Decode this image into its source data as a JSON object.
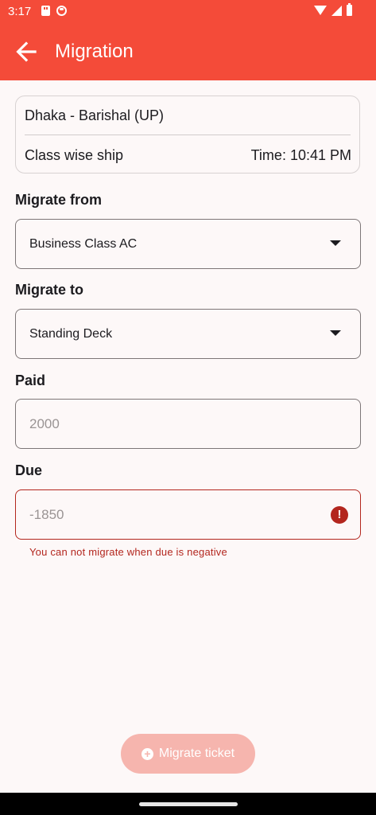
{
  "status_bar": {
    "time": "3:17",
    "left_icons": [
      "sd-card-icon",
      "camera-icon"
    ],
    "right_icons": [
      "wifi-icon",
      "signal-icon",
      "battery-icon"
    ]
  },
  "app_bar": {
    "title": "Migration",
    "back_icon": "arrow-left-icon",
    "background": "#f44b39"
  },
  "route_card": {
    "route": "Dhaka - Barishal (UP)",
    "ship_type": "Class wise ship",
    "time": "Time: 10:41 PM"
  },
  "form": {
    "migrate_from": {
      "label": "Migrate from",
      "value": "Business Class AC"
    },
    "migrate_to": {
      "label": "Migrate to",
      "value": "Standing Deck"
    },
    "paid": {
      "label": "Paid",
      "placeholder": "2000"
    },
    "due": {
      "label": "Due",
      "placeholder": "-1850",
      "error": "You can not migrate when due is negative",
      "error_color": "#b3261e"
    }
  },
  "migrate_button": {
    "label": "Migrate ticket",
    "icon": "plus-circle-icon",
    "state": "disabled"
  }
}
